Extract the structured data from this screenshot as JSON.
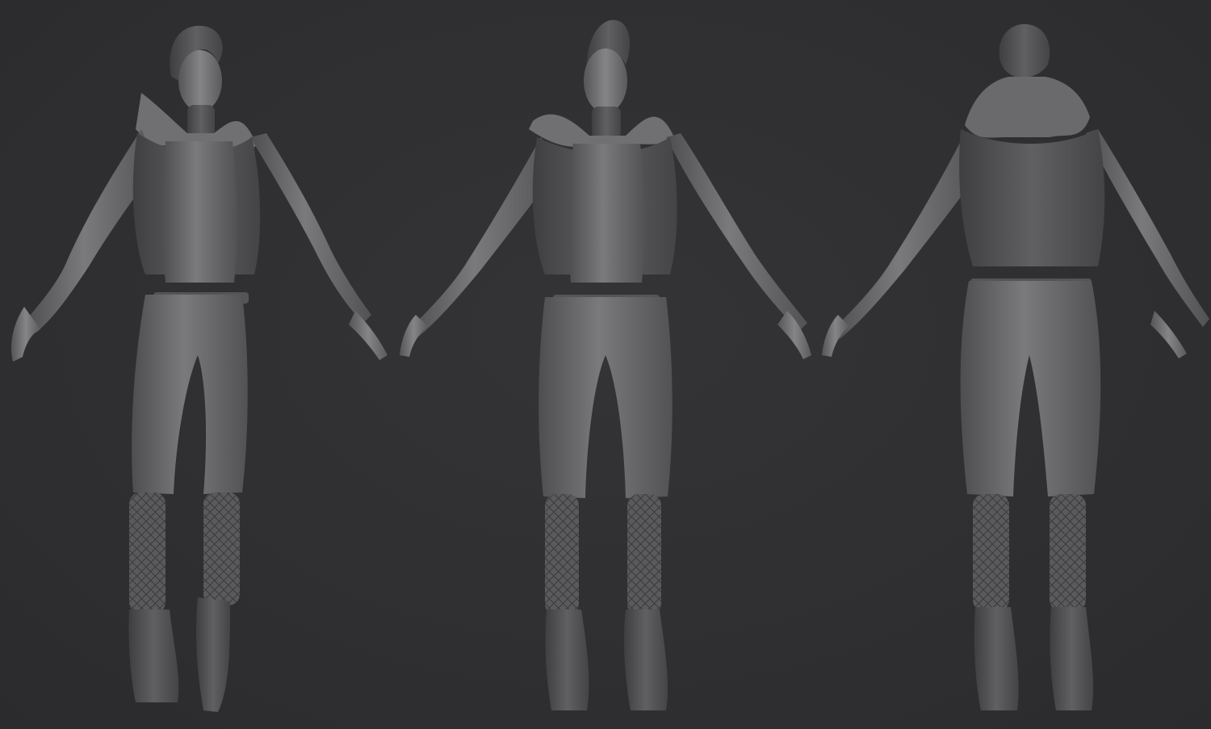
{
  "scene": {
    "background_color": "#2f2f31",
    "clay_color": "#6b6b6d",
    "clay_shadow": "#4a4a4c",
    "clay_highlight": "#8a8a8c",
    "views": [
      {
        "id": "three-quarter",
        "facing": "front-left"
      },
      {
        "id": "front",
        "facing": "front"
      },
      {
        "id": "back",
        "facing": "back"
      }
    ]
  }
}
